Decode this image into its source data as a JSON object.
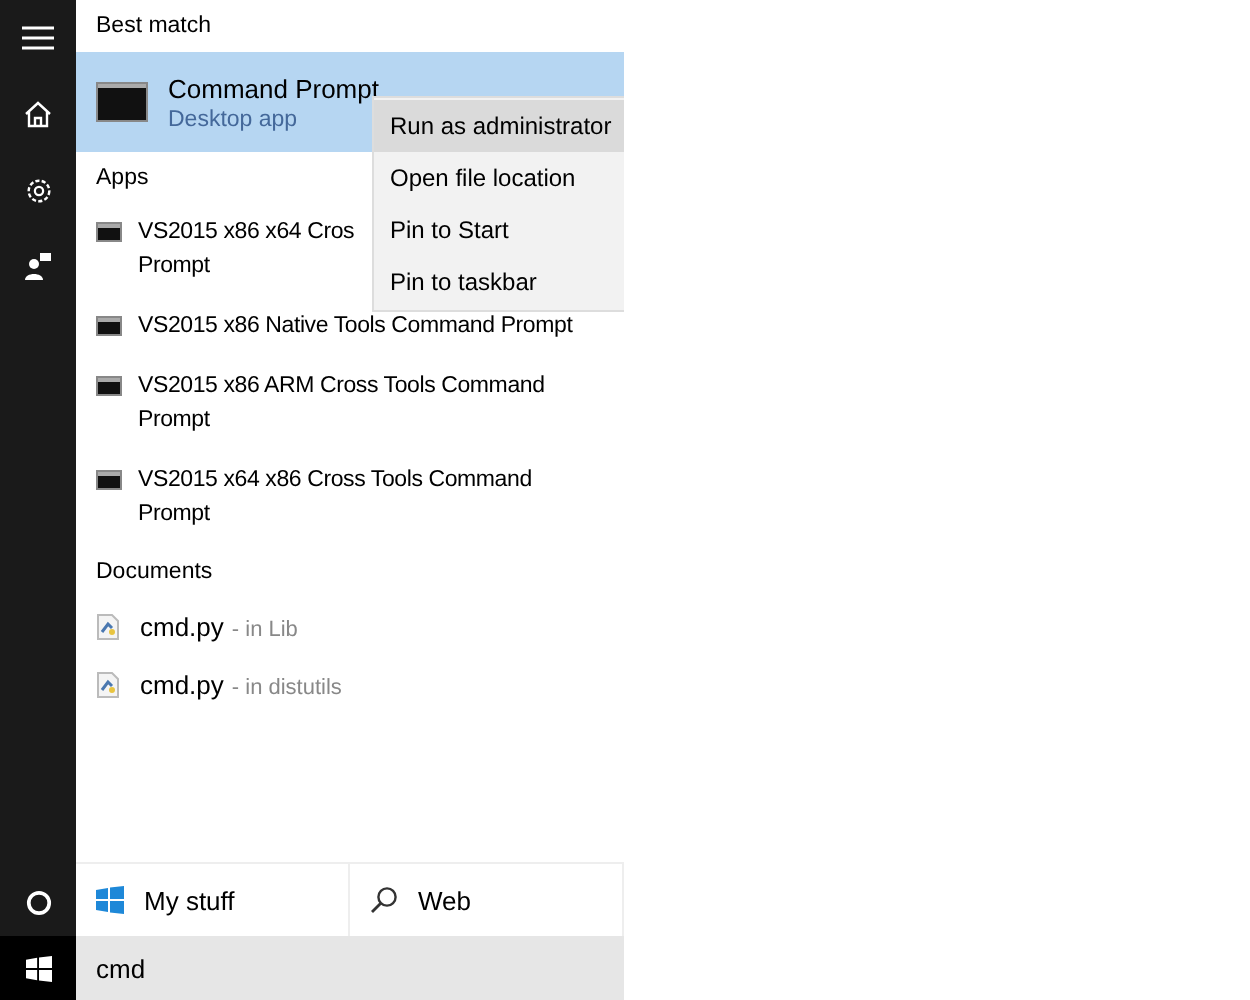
{
  "rail": {
    "items": [
      {
        "kind": "menu"
      },
      {
        "kind": "home"
      },
      {
        "kind": "settings"
      },
      {
        "kind": "feedback"
      }
    ],
    "bottom": [
      {
        "kind": "cortana"
      },
      {
        "kind": "start"
      }
    ]
  },
  "best_match": {
    "heading": "Best match",
    "item": {
      "title": "Command Prompt",
      "subtitle": "Desktop app",
      "selected": true
    }
  },
  "apps": {
    "heading": "Apps",
    "items": [
      {
        "lines": [
          "VS2015 x86 x64 Cros",
          "Prompt"
        ]
      },
      {
        "lines": [
          "VS2015 x86 Native Tools Command Prompt"
        ]
      },
      {
        "lines": [
          "VS2015 x86 ARM Cross Tools Command",
          "Prompt"
        ]
      },
      {
        "lines": [
          "VS2015 x64 x86 Cross Tools Command",
          "Prompt"
        ]
      }
    ]
  },
  "documents": {
    "heading": "Documents",
    "items": [
      {
        "name": "cmd.py",
        "location": "- in Lib"
      },
      {
        "name": "cmd.py",
        "location": "- in distutils"
      }
    ]
  },
  "context_menu": {
    "items": [
      {
        "label": "Run as administrator",
        "selected": true
      },
      {
        "label": "Open file location",
        "selected": false
      },
      {
        "label": "Pin to Start",
        "selected": false
      },
      {
        "label": "Pin to taskbar",
        "selected": false
      }
    ]
  },
  "scopes": [
    {
      "kind": "mystuff",
      "label": "My stuff"
    },
    {
      "kind": "web",
      "label": "Web"
    }
  ],
  "search": {
    "value": "cmd"
  }
}
